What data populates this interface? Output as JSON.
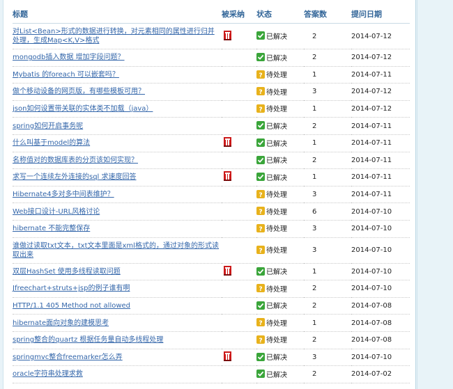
{
  "header": {
    "title": "标题",
    "adopted": "被采纳",
    "status": "状态",
    "answers": "答案数",
    "date": "提问日期"
  },
  "colors": {
    "link": "#3366aa",
    "header_text": "#336699",
    "resolved": "#3aa53a",
    "pending": "#e8b21c",
    "adopted": "#cc1a1a"
  },
  "icons": {
    "adopted": "adopted-badge-icon",
    "resolved": "check-icon",
    "pending": "question-icon"
  },
  "rows": [
    {
      "title": "对List<Bean>形式的数据进行转换，对元素相同的属性进行归并处理，生成Map<K,V>格式",
      "adopted": true,
      "status": "已解决",
      "resolved": true,
      "answers": "2",
      "date": "2014-07-12"
    },
    {
      "title": "mongodb插入数据 增加字段问题？",
      "adopted": false,
      "status": "已解决",
      "resolved": true,
      "answers": "2",
      "date": "2014-07-12"
    },
    {
      "title": "Mybatis 的foreach 可以嵌套吗？",
      "adopted": false,
      "status": "待处理",
      "resolved": false,
      "answers": "1",
      "date": "2014-07-11"
    },
    {
      "title": "做个移动设备的网页版，有哪些模板可用？",
      "adopted": false,
      "status": "待处理",
      "resolved": false,
      "answers": "3",
      "date": "2014-07-12"
    },
    {
      "title": "json如何设置带关联的实体类不加载（java）",
      "adopted": false,
      "status": "待处理",
      "resolved": false,
      "answers": "1",
      "date": "2014-07-12"
    },
    {
      "title": "spring如何开启事务呢",
      "adopted": false,
      "status": "已解决",
      "resolved": true,
      "answers": "2",
      "date": "2014-07-11"
    },
    {
      "title": "什么叫基于model的算法",
      "adopted": true,
      "status": "已解决",
      "resolved": true,
      "answers": "1",
      "date": "2014-07-11"
    },
    {
      "title": "名称值对的数据库表的分页该如何实现？",
      "adopted": false,
      "status": "已解决",
      "resolved": true,
      "answers": "2",
      "date": "2014-07-11"
    },
    {
      "title": "求写一个连续左外连接的sql 求速度回答",
      "adopted": true,
      "status": "已解决",
      "resolved": true,
      "answers": "1",
      "date": "2014-07-11"
    },
    {
      "title": "Hibernate4多对多中间表维护？",
      "adopted": false,
      "status": "待处理",
      "resolved": false,
      "answers": "3",
      "date": "2014-07-11"
    },
    {
      "title": "Web接口设计-URL风格讨论",
      "adopted": false,
      "status": "待处理",
      "resolved": false,
      "answers": "6",
      "date": "2014-07-10"
    },
    {
      "title": "hibernate 不能完整保存",
      "adopted": false,
      "status": "待处理",
      "resolved": false,
      "answers": "3",
      "date": "2014-07-10"
    },
    {
      "title": "谁做过读取txt文本，txt文本里面是xml格式的，通过对象的形式读取出来",
      "adopted": false,
      "status": "待处理",
      "resolved": false,
      "answers": "3",
      "date": "2014-07-10"
    },
    {
      "title": "双层HashSet 使用多线程读取问题",
      "adopted": true,
      "status": "已解决",
      "resolved": true,
      "answers": "1",
      "date": "2014-07-10"
    },
    {
      "title": "Jfreechart+struts+jsp的例子谁有啊",
      "adopted": false,
      "status": "待处理",
      "resolved": false,
      "answers": "2",
      "date": "2014-07-10"
    },
    {
      "title": "HTTP/1.1 405 Method not allowed",
      "adopted": false,
      "status": "已解决",
      "resolved": true,
      "answers": "2",
      "date": "2014-07-08"
    },
    {
      "title": "hibernate面向对象的建模思考",
      "adopted": false,
      "status": "待处理",
      "resolved": false,
      "answers": "1",
      "date": "2014-07-08"
    },
    {
      "title": "spring整合的quartz 根据任务量自动多线程处理",
      "adopted": false,
      "status": "待处理",
      "resolved": false,
      "answers": "2",
      "date": "2014-07-08"
    },
    {
      "title": "springmvc整合freemarker怎么弄",
      "adopted": true,
      "status": "已解决",
      "resolved": true,
      "answers": "3",
      "date": "2014-07-10"
    },
    {
      "title": "oracle字符串处理求救",
      "adopted": false,
      "status": "已解决",
      "resolved": true,
      "answers": "2",
      "date": "2014-07-02"
    }
  ]
}
